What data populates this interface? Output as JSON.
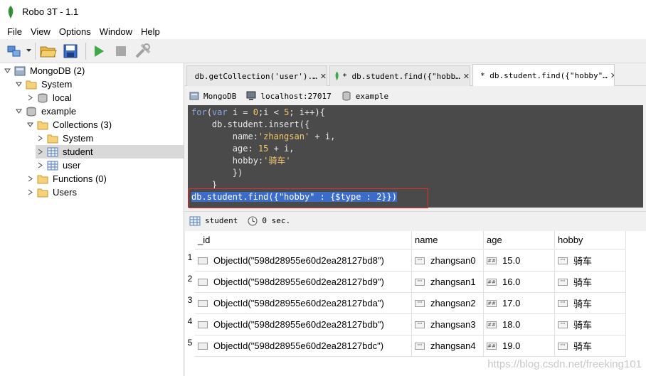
{
  "window": {
    "title": "Robo 3T - 1.1"
  },
  "menu": [
    "File",
    "View",
    "Options",
    "Window",
    "Help"
  ],
  "tree": {
    "root": "MongoDB (2)",
    "system": "System",
    "local": "local",
    "example": "example",
    "collections": "Collections (3)",
    "system_col": "System",
    "student": "student",
    "user": "user",
    "functions": "Functions (0)",
    "users": "Users"
  },
  "tabs": [
    {
      "label": "db.getCollection('user').…"
    },
    {
      "label": "* db.student.find({\"hobb…"
    },
    {
      "label": "* db.student.find({\"hobby\"…"
    }
  ],
  "connection": {
    "server": "MongoDB",
    "host": "localhost:27017",
    "db": "example"
  },
  "editor": {
    "l1_a": "for",
    "l1_b": "(",
    "l1_c": "var",
    "l1_d": " i = ",
    "l1_e": "0",
    "l1_f": ";i < ",
    "l1_g": "5",
    "l1_h": "; i++){",
    "l2": "    db.student.insert({",
    "l3_a": "        name:",
    "l3_b": "'zhangsan'",
    "l3_c": " + i,",
    "l4_a": "        age: ",
    "l4_b": "15",
    "l4_c": " + i,",
    "l5_a": "        hobby:",
    "l5_b": "'骑车'",
    "l6": "        })",
    "l7": "    }",
    "l8": "db.student.find({\"hobby\" : {$type : 2}})"
  },
  "result": {
    "collection": "student",
    "time": "0 sec."
  },
  "columns": [
    "_id",
    "name",
    "age",
    "hobby"
  ],
  "rows": [
    {
      "n": "1",
      "id": "ObjectId(\"598d28955e60d2ea28127bd8\")",
      "name": "zhangsan0",
      "age": "15.0",
      "hobby": "骑车"
    },
    {
      "n": "2",
      "id": "ObjectId(\"598d28955e60d2ea28127bd9\")",
      "name": "zhangsan1",
      "age": "16.0",
      "hobby": "骑车"
    },
    {
      "n": "3",
      "id": "ObjectId(\"598d28955e60d2ea28127bda\")",
      "name": "zhangsan2",
      "age": "17.0",
      "hobby": "骑车"
    },
    {
      "n": "4",
      "id": "ObjectId(\"598d28955e60d2ea28127bdb\")",
      "name": "zhangsan3",
      "age": "18.0",
      "hobby": "骑车"
    },
    {
      "n": "5",
      "id": "ObjectId(\"598d28955e60d2ea28127bdc\")",
      "name": "zhangsan4",
      "age": "19.0",
      "hobby": "骑车"
    }
  ],
  "type_tags": {
    "string": "\"\"",
    "number": "##"
  },
  "watermark": "https://blog.csdn.net/freeking101"
}
